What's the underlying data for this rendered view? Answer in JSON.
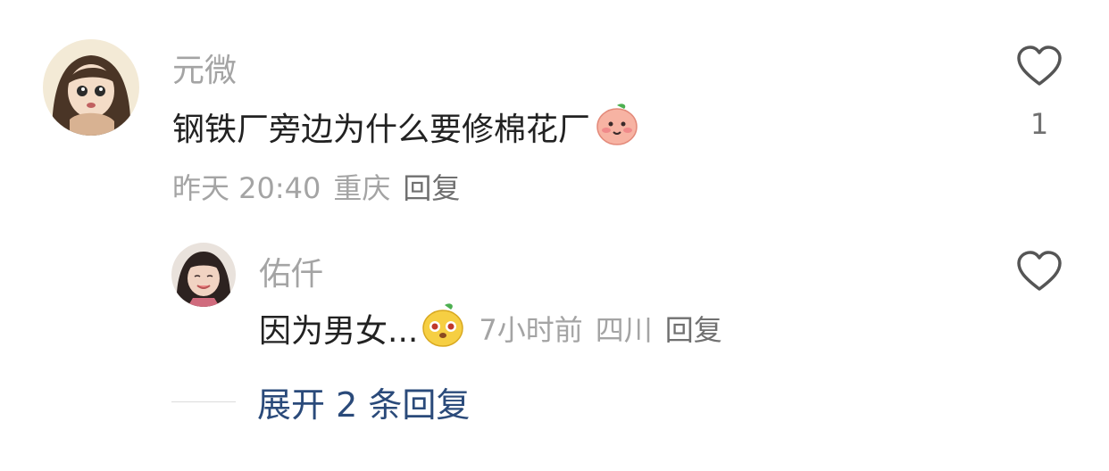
{
  "comments": [
    {
      "username": "元微",
      "text": "钢铁厂旁边为什么要修棉花厂",
      "emoji_icon": "blush-peach-emoji-icon",
      "time": "昨天 20:40",
      "location": "重庆",
      "reply_label": "回复",
      "like_count": "1",
      "replies": [
        {
          "username": "佑仟",
          "text": "因为男女...",
          "emoji_icon": "shy-yellow-emoji-icon",
          "time": "7小时前",
          "location": "四川",
          "reply_label": "回复"
        }
      ],
      "expand_label": "展开 2 条回复"
    }
  ],
  "colors": {
    "username": "#a4a4a4",
    "text": "#222222",
    "meta": "#a4a4a4",
    "expand": "#2a4a7a",
    "heart": "#555555"
  }
}
